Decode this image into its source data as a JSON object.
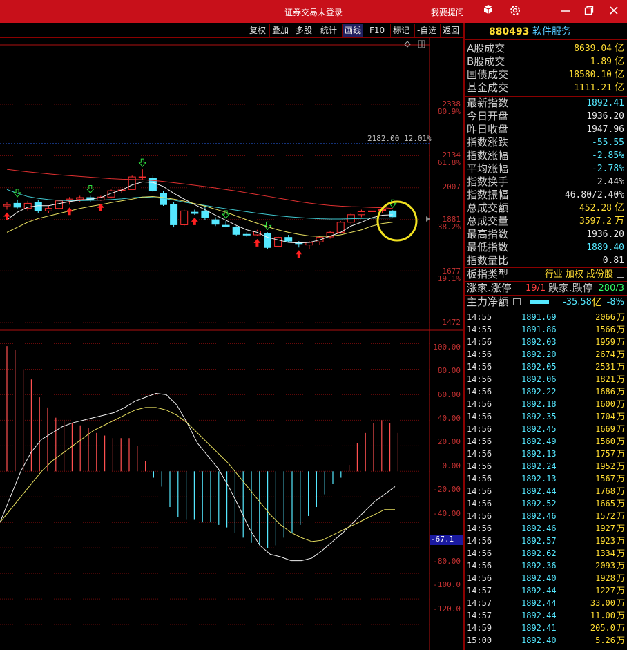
{
  "titlebar": {
    "title": "证券交易未登录",
    "ask": "我要提问",
    "icons": [
      "cube-icon",
      "gear-icon",
      "minimize-icon",
      "restore-icon",
      "close-icon"
    ]
  },
  "toolbar": {
    "buttons": [
      "复权",
      "叠加",
      "多股",
      "统计",
      "画线",
      "F10",
      "标记",
      "-自选",
      "返回"
    ]
  },
  "price_axis": {
    "labels": [
      "2338",
      "80.9%",
      "2134",
      "61.8%",
      "2007",
      "1881",
      "38.2%",
      "1677",
      "19.1%",
      "1472"
    ],
    "marker": "2182.00 12.01%"
  },
  "macd_axis": {
    "labels": [
      "100.00",
      "80.00",
      "60.00",
      "40.00",
      "20.00",
      "0.00",
      "-20.00",
      "-40.00",
      "-67.1",
      "-80.00",
      "-100.0",
      "-120.0"
    ]
  },
  "chart_data": {
    "type": "candlestick",
    "price_panel": {
      "ylim": [
        1472,
        2338
      ],
      "candles": [
        [
          1935,
          1950,
          1920,
          1940
        ],
        [
          1945,
          1960,
          1925,
          1930
        ],
        [
          1925,
          1955,
          1915,
          1945
        ],
        [
          1950,
          1960,
          1905,
          1915
        ],
        [
          1915,
          1935,
          1905,
          1925
        ],
        [
          1925,
          1960,
          1920,
          1955
        ],
        [
          1955,
          1970,
          1940,
          1962
        ],
        [
          1962,
          1975,
          1950,
          1968
        ],
        [
          1968,
          1975,
          1950,
          1958
        ],
        [
          1958,
          1975,
          1955,
          1970
        ],
        [
          1970,
          2000,
          1965,
          1995
        ],
        [
          1995,
          2002,
          1985,
          1998
        ],
        [
          2000,
          2055,
          2000,
          2050
        ],
        [
          2050,
          2080,
          2040,
          2050
        ],
        [
          2045,
          2058,
          1990,
          1995
        ],
        [
          1985,
          1995,
          1935,
          1940
        ],
        [
          1940,
          1950,
          1850,
          1860
        ],
        [
          1860,
          1920,
          1855,
          1915
        ],
        [
          1910,
          1920,
          1900,
          1905
        ],
        [
          1915,
          1935,
          1880,
          1890
        ],
        [
          1880,
          1890,
          1855,
          1862
        ],
        [
          1858,
          1875,
          1850,
          1854
        ],
        [
          1850,
          1855,
          1815,
          1822
        ],
        [
          1822,
          1830,
          1812,
          1820
        ],
        [
          1820,
          1840,
          1815,
          1835
        ],
        [
          1825,
          1830,
          1765,
          1770
        ],
        [
          1775,
          1815,
          1770,
          1810
        ],
        [
          1810,
          1820,
          1790,
          1795
        ],
        [
          1790,
          1795,
          1770,
          1785
        ],
        [
          1780,
          1795,
          1765,
          1790
        ],
        [
          1792,
          1815,
          1780,
          1810
        ],
        [
          1812,
          1835,
          1805,
          1830
        ],
        [
          1830,
          1875,
          1825,
          1870
        ],
        [
          1870,
          1905,
          1860,
          1900
        ],
        [
          1900,
          1920,
          1890,
          1912
        ],
        [
          1912,
          1925,
          1900,
          1915
        ],
        [
          1918,
          1928,
          1905,
          1920
        ],
        [
          1915,
          1918,
          1890,
          1892
        ]
      ],
      "series": [
        {
          "name": "MA-red",
          "color": "#e03030",
          "values": [
            2080,
            2075,
            2070,
            2066,
            2062,
            2058,
            2055,
            2052,
            2049,
            2046,
            2043,
            2041,
            2040,
            2039,
            2036,
            2032,
            2027,
            2022,
            2017,
            2012,
            2006,
            2000,
            1994,
            1987,
            1980,
            1973,
            1966,
            1959,
            1952,
            1946,
            1941,
            1937,
            1934,
            1932,
            1931,
            1929,
            1928,
            1925
          ]
        },
        {
          "name": "MA-cyan",
          "color": "#40c8d0",
          "values": [
            2000,
            1985,
            1972,
            1965,
            1960,
            1957,
            1956,
            1956,
            1957,
            1958,
            1960,
            1963,
            1967,
            1970,
            1968,
            1965,
            1958,
            1950,
            1943,
            1937,
            1930,
            1924,
            1918,
            1912,
            1906,
            1901,
            1896,
            1892,
            1889,
            1886,
            1884,
            1883,
            1883,
            1884,
            1885,
            1886,
            1887,
            1887
          ]
        },
        {
          "name": "MA-white",
          "color": "#f0f0f0",
          "values": [
            1880,
            1910,
            1930,
            1936,
            1936,
            1944,
            1952,
            1958,
            1962,
            1968,
            1985,
            1998,
            2018,
            2030,
            2028,
            2012,
            1985,
            1962,
            1940,
            1920,
            1898,
            1878,
            1858,
            1840,
            1830,
            1810,
            1800,
            1790,
            1788,
            1790,
            1800,
            1815,
            1830,
            1855,
            1870,
            1888,
            1898,
            1900
          ]
        },
        {
          "name": "MA-yellow",
          "color": "#e8e060",
          "values": [
            1830,
            1850,
            1870,
            1885,
            1895,
            1905,
            1915,
            1925,
            1933,
            1940,
            1948,
            1955,
            1962,
            1970,
            1972,
            1968,
            1962,
            1954,
            1944,
            1934,
            1922,
            1910,
            1895,
            1880,
            1866,
            1852,
            1840,
            1830,
            1822,
            1816,
            1814,
            1815,
            1820,
            1830,
            1840,
            1855,
            1865,
            1870
          ]
        }
      ]
    },
    "macd_panel": {
      "ylim": [
        -140,
        110
      ],
      "histogram": [
        98,
        95,
        80,
        72,
        58,
        50,
        42,
        40,
        38,
        36,
        34,
        30,
        28,
        26,
        26,
        26,
        20,
        8,
        -5,
        -12,
        -28,
        -36,
        -38,
        -38,
        -40,
        -40,
        -42,
        -44,
        -48,
        -52,
        -56,
        -58,
        -60,
        -58,
        -52,
        -48,
        -42,
        -35,
        -28,
        -18,
        -10,
        -5,
        5,
        22,
        30,
        38,
        40,
        38,
        30
      ],
      "dif": [
        -40,
        -20,
        0,
        15,
        25,
        30,
        35,
        38,
        40,
        42,
        44,
        46,
        50,
        55,
        58,
        61,
        60,
        52,
        38,
        22,
        12,
        2,
        -12,
        -28,
        -45,
        -58,
        -65,
        -67,
        -70,
        -70,
        -68,
        -62,
        -55,
        -48,
        -40,
        -32,
        -24,
        -18,
        -12
      ],
      "dea": [
        -40,
        -30,
        -20,
        -10,
        0,
        8,
        14,
        20,
        26,
        32,
        36,
        40,
        44,
        48,
        50,
        50,
        48,
        44,
        38,
        30,
        22,
        14,
        6,
        -4,
        -14,
        -24,
        -34,
        -42,
        -48,
        -52,
        -55,
        -54,
        -50,
        -46,
        -42,
        -38,
        -34,
        -30,
        -30
      ],
      "dif_label": "-67.1"
    }
  },
  "panel": {
    "code": "880493",
    "name": "软件服务",
    "trade_rows": [
      {
        "label": "A股成交",
        "value": "8639.04",
        "unit": "亿"
      },
      {
        "label": "B股成交",
        "value": "1.89",
        "unit": "亿"
      },
      {
        "label": "国债成交",
        "value": "18580.10",
        "unit": "亿"
      },
      {
        "label": "基金成交",
        "value": "1111.21",
        "unit": "亿"
      }
    ],
    "index_rows": [
      {
        "label": "最新指数",
        "value": "1892.41",
        "color": "cyan"
      },
      {
        "label": "今日开盘",
        "value": "1936.20",
        "color": "white"
      },
      {
        "label": "昨日收盘",
        "value": "1947.96",
        "color": "white"
      },
      {
        "label": "指数涨跌",
        "value": "-55.55",
        "color": "cyan"
      },
      {
        "label": "指数涨幅",
        "value": "-2.85%",
        "color": "cyan"
      },
      {
        "label": "平均涨幅",
        "value": "-2.78%",
        "color": "cyan"
      },
      {
        "label": "指数换手",
        "value": "2.44%",
        "color": "white"
      },
      {
        "label": "指数振幅",
        "value": "46.80/2.40%",
        "color": "white"
      },
      {
        "label": "总成交额",
        "value": "452.28",
        "unit": "亿",
        "color": "yellow"
      },
      {
        "label": "总成交量",
        "value": "3597.2",
        "unit": "万",
        "color": "yellow"
      },
      {
        "label": "最高指数",
        "value": "1936.20",
        "color": "white"
      },
      {
        "label": "最低指数",
        "value": "1889.40",
        "color": "cyan"
      },
      {
        "label": "指数量比",
        "value": "0.81",
        "color": "white"
      }
    ],
    "type_row": {
      "label": "板指类型",
      "value": "行业 加权 成份股"
    },
    "limit_row": {
      "label1": "涨家.涨停",
      "value1": "19/1",
      "label2": "跌家.跌停",
      "value2": "280/3"
    },
    "main_row": {
      "label": "主力净额",
      "value": "-35.58",
      "unit": "亿",
      "pct": "-8%"
    },
    "ticks": [
      [
        "14:55",
        "1891.69",
        "2066",
        "万"
      ],
      [
        "14:55",
        "1891.86",
        "1566",
        "万"
      ],
      [
        "14:56",
        "1892.03",
        "1959",
        "万"
      ],
      [
        "14:56",
        "1892.20",
        "2674",
        "万"
      ],
      [
        "14:56",
        "1892.05",
        "2531",
        "万"
      ],
      [
        "14:56",
        "1892.06",
        "1821",
        "万"
      ],
      [
        "14:56",
        "1892.22",
        "1686",
        "万"
      ],
      [
        "14:56",
        "1892.18",
        "1600",
        "万"
      ],
      [
        "14:56",
        "1892.35",
        "1704",
        "万"
      ],
      [
        "14:56",
        "1892.45",
        "1669",
        "万"
      ],
      [
        "14:56",
        "1892.49",
        "1560",
        "万"
      ],
      [
        "14:56",
        "1892.13",
        "1757",
        "万"
      ],
      [
        "14:56",
        "1892.24",
        "1952",
        "万"
      ],
      [
        "14:56",
        "1892.13",
        "1567",
        "万"
      ],
      [
        "14:56",
        "1892.44",
        "1768",
        "万"
      ],
      [
        "14:56",
        "1892.52",
        "1665",
        "万"
      ],
      [
        "14:56",
        "1892.46",
        "1572",
        "万"
      ],
      [
        "14:56",
        "1892.46",
        "1927",
        "万"
      ],
      [
        "14:56",
        "1892.57",
        "1923",
        "万"
      ],
      [
        "14:56",
        "1892.62",
        "1334",
        "万"
      ],
      [
        "14:56",
        "1892.36",
        "2093",
        "万"
      ],
      [
        "14:56",
        "1892.40",
        "1928",
        "万"
      ],
      [
        "14:57",
        "1892.44",
        "1227",
        "万"
      ],
      [
        "14:57",
        "1892.44",
        "33.00",
        "万"
      ],
      [
        "14:57",
        "1892.44",
        "11.00",
        "万"
      ],
      [
        "14:59",
        "1892.41",
        "205.0",
        "万"
      ],
      [
        "15:00",
        "1892.40",
        "5.26",
        "万"
      ]
    ]
  }
}
